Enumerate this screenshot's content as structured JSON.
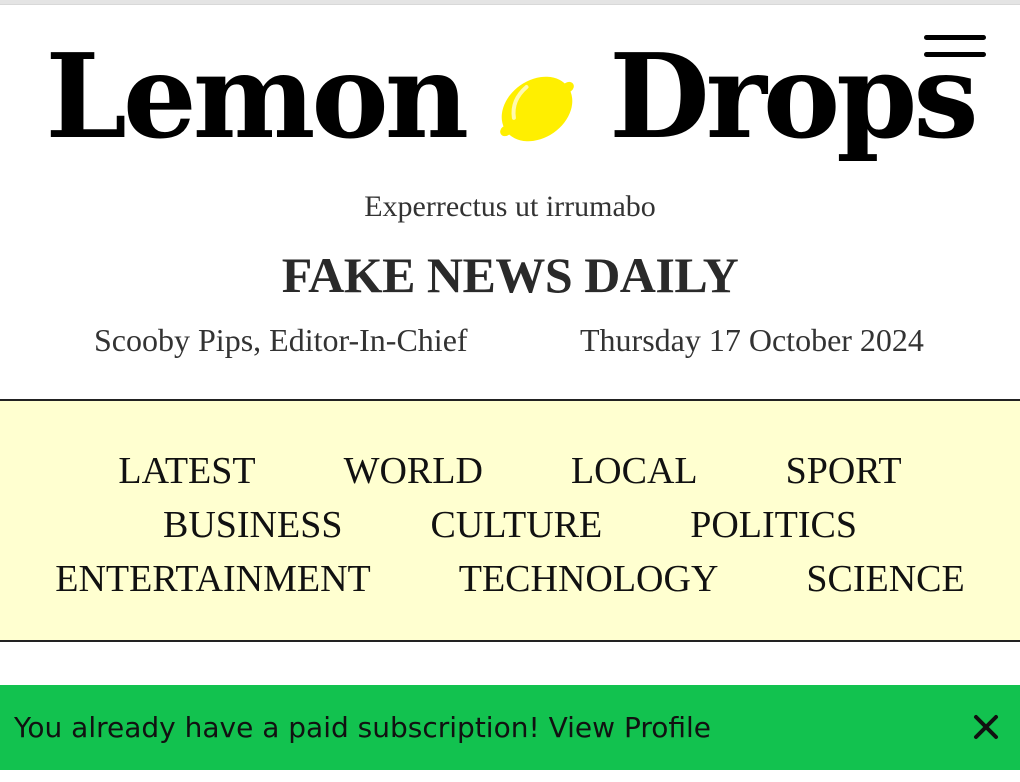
{
  "masthead": {
    "title_left": "Lemon",
    "logo_icon": "lemon-icon",
    "title_right": "Drops",
    "menu_icon": "hamburger-menu-icon"
  },
  "tagline": "Experrectus ut irrumabo",
  "headline": "FAKE NEWS DAILY",
  "byline": {
    "editor": "Scooby Pips, Editor-In-Chief",
    "date": "Thursday 17 October 2024"
  },
  "nav": {
    "row1": [
      "LATEST",
      "WORLD",
      "LOCAL",
      "SPORT"
    ],
    "row2": [
      "BUSINESS",
      "CULTURE",
      "POLITICS"
    ],
    "row3": [
      "ENTERTAINMENT",
      "TECHNOLOGY",
      "SCIENCE"
    ]
  },
  "banner": {
    "message": "You already have a paid subscription!",
    "link_label": "View Profile",
    "close_icon": "close-icon"
  },
  "colors": {
    "nav_background": "#ffffd0",
    "banner_background": "#12c24f",
    "lemon": "#ffef00"
  }
}
